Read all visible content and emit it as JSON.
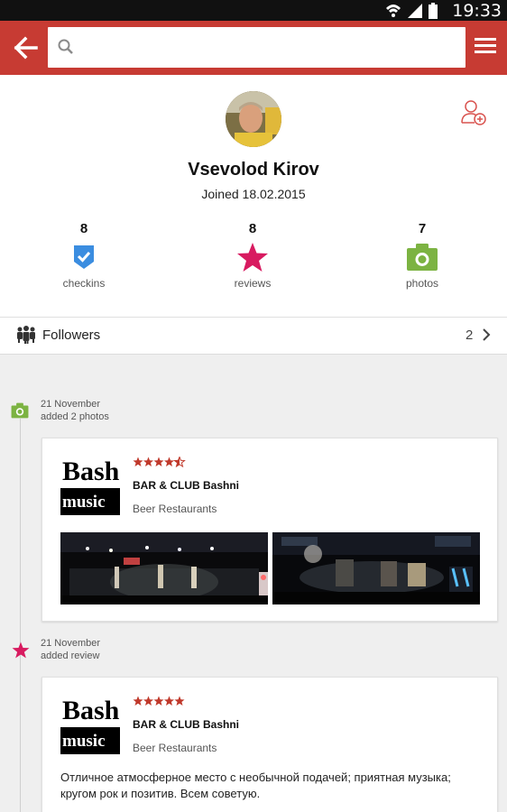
{
  "status_bar": {
    "time": "19:33"
  },
  "search": {
    "placeholder": "",
    "value": ""
  },
  "profile": {
    "name": "Vsevolod Kirov",
    "joined": "Joined 18.02.2015",
    "stats": [
      {
        "count": "8",
        "label": "checkins",
        "icon": "checkin-shield-icon",
        "color": "#3b8de0"
      },
      {
        "count": "8",
        "label": "reviews",
        "icon": "star-icon",
        "color": "#d81b60"
      },
      {
        "count": "7",
        "label": "photos",
        "icon": "camera-icon",
        "color": "#7cb342"
      }
    ]
  },
  "followers": {
    "label": "Followers",
    "count": "2"
  },
  "feed": [
    {
      "icon": "camera-icon",
      "date": "21 November",
      "action": "added 2 photos",
      "venue": {
        "logo_line1": "Bash",
        "logo_line2": "music",
        "name": "BAR & CLUB Bashni",
        "category": "Beer Restaurants",
        "rating": 4.5
      }
    },
    {
      "icon": "star-icon",
      "date": "21 November",
      "action": "added review",
      "venue": {
        "logo_line1": "Bash",
        "logo_line2": "music",
        "name": "BAR & CLUB Bashni",
        "category": "Beer Restaurants",
        "rating": 5
      },
      "review": "Отличное атмосферное место с необычной подачей; приятная музыка; кругом рок и позитив. Всем советую."
    }
  ],
  "colors": {
    "toolbar": "#c73b33",
    "accent_star": "#d81b60",
    "rating_star": "#c0392b"
  }
}
